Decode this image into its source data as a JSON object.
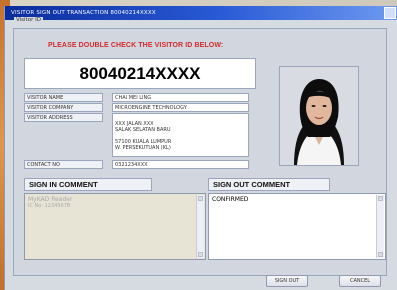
{
  "window": {
    "title": "VISITOR SIGN OUT TRANSACTION 80040214XXXX"
  },
  "frame": {
    "label": "Visitor ID",
    "warning": "PLEASE DOUBLE CHECK THE VISITOR ID BELOW:"
  },
  "visitor": {
    "id": "80040214XXXX",
    "fields": [
      {
        "label": "VISITOR NAME",
        "value": "CHAI MEI LING"
      },
      {
        "label": "VISITOR COMPANY",
        "value": "MICROENGINE TECHNOLOGY"
      },
      {
        "label": "VISITOR ADDRESS",
        "value": "XXX JALAN XXX\nSALAK SELATAN BARU\n\n57100 KUALA LUMPUR\nW. PERSEKUTUAN (KL)"
      },
      {
        "label": "CONTACT NO",
        "value": "0321234XXX"
      }
    ]
  },
  "sign_in": {
    "header": "SIGN IN COMMENT",
    "text_line1": "MyKAD Reader",
    "text_line2": "IC No: 1234567B"
  },
  "sign_out": {
    "header": "SIGN OUT COMMENT",
    "text": "CONFIRMED"
  },
  "buttons": {
    "sign_out": "SIGN OUT",
    "cancel": "CANCEL"
  },
  "colors": {
    "title_start": "#0a2c9c",
    "warning": "#d12b2b"
  }
}
